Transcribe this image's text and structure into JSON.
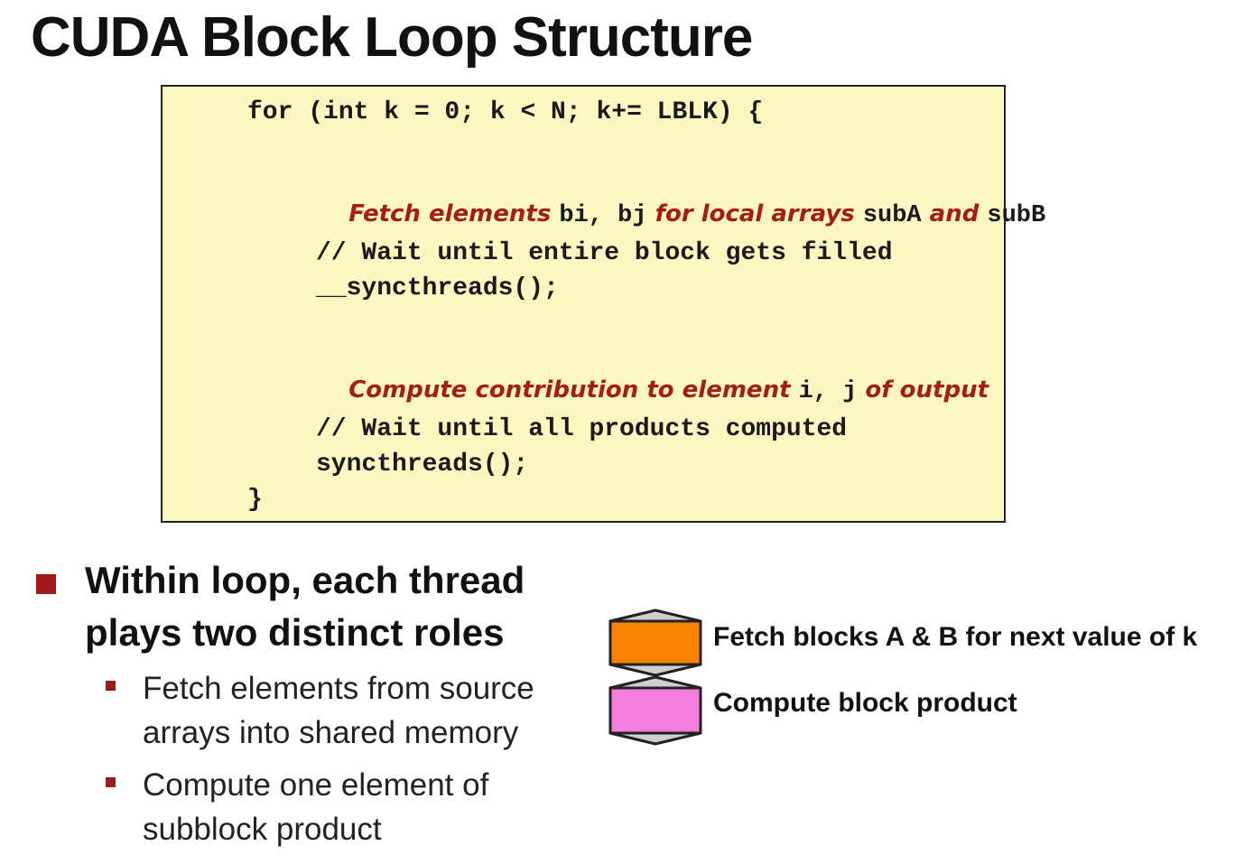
{
  "title": "CUDA Block Loop Structure",
  "code": {
    "loop_header": "for (int k = 0; k < N; k+= LBLK) {",
    "fetch": {
      "t1": "Fetch elements ",
      "m1": "bi, bj",
      "t2": " for local arrays ",
      "m2": "subA",
      "t3": " and ",
      "m3": "subB"
    },
    "wait_comment_1": "// Wait until entire block gets filled",
    "sync_1": "__syncthreads();",
    "compute": {
      "t1": "Compute contribution to element ",
      "m1": "i, j",
      "t2": " of output"
    },
    "wait_comment_2": "// Wait until all products computed",
    "sync_2": "syncthreads();",
    "close_brace": "}"
  },
  "bullets": {
    "main_line1": "Within loop, each thread",
    "main_line2": "plays two distinct roles",
    "sub1_line1": "Fetch elements from source",
    "sub1_line2": "arrays into shared memory",
    "sub2_line1": "Compute one element of",
    "sub2_line2": "subblock product"
  },
  "legend": {
    "fetch_label": "Fetch blocks A & B for next value of k",
    "compute_label": "Compute block product",
    "fetch_color": "#fb8200",
    "compute_color": "#f47ddc",
    "hex_outline_color": "#cfcfcf"
  },
  "colors": {
    "code_background": "#fcf6c0",
    "pseudo_text": "#a31e13",
    "bullet": "#a01a1a"
  }
}
